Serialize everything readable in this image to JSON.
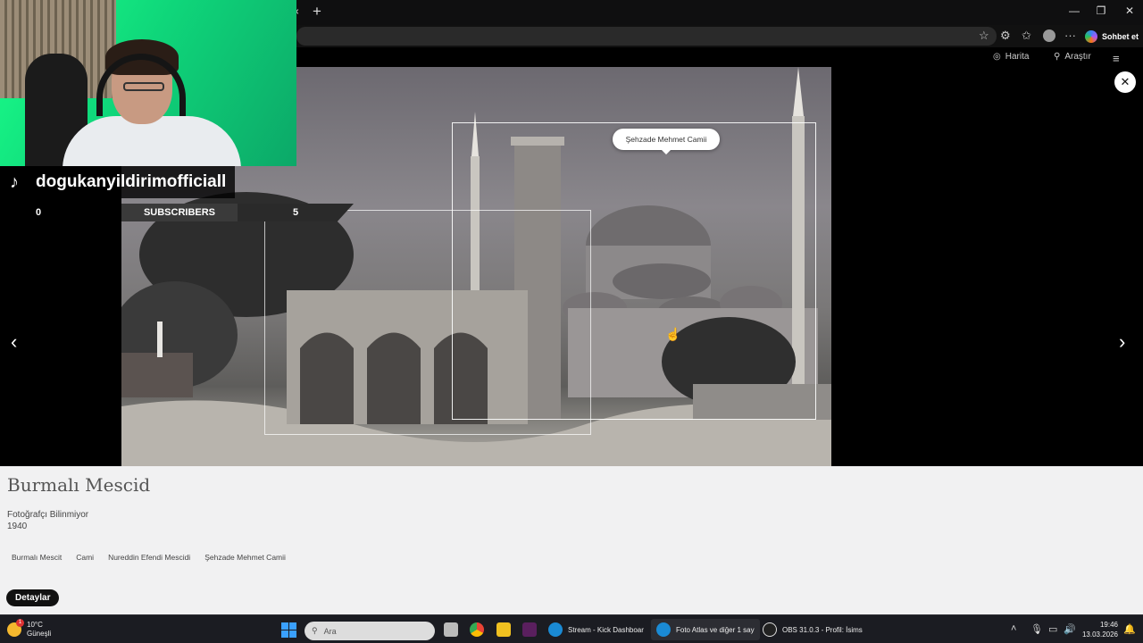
{
  "browser": {
    "tab_close": "×",
    "new_tab": "+",
    "window": {
      "minimize": "—",
      "restore": "❐",
      "close": "✕"
    },
    "address_icons": {
      "favorite": "☆",
      "more": "···"
    },
    "copilot_label": "Sohbet et"
  },
  "viewer": {
    "nav": {
      "map_label": "Harita",
      "search_label": "Araştır"
    },
    "close": "✕",
    "prev": "‹",
    "next": "›",
    "tooltip": "Şehzade Mehmet Camii"
  },
  "stream_overlay": {
    "tiktok_handle": "dogukanyildirimofficiall",
    "counter_left": "0",
    "subscribers_label": "SUBSCRIBERS",
    "counter_right": "5"
  },
  "info": {
    "title": "Burmalı Mescid",
    "photographer": "Fotoğrafçı Bilinmiyor",
    "year": "1940",
    "tags": [
      "Burmalı Mescit",
      "Cami",
      "Nureddin Efendi Mescidi",
      "Şehzade Mehmet Camii"
    ],
    "details_button": "Detaylar"
  },
  "taskbar": {
    "weather_temp": "10°C",
    "weather_desc": "Güneşli",
    "weather_badge": "1",
    "search_placeholder": "Ara",
    "apps": [
      {
        "label": "Stream - Kick Dashboar",
        "color": "#0b8f5a"
      },
      {
        "label": "Foto Atlas ve diğer 1 say",
        "color": "#1a8ad4"
      },
      {
        "label": "OBS 31.0.3 - Profil: İsims",
        "color": "#222222"
      }
    ],
    "time": "19:46",
    "date": "13.03.2026"
  },
  "colors": {
    "accent": "#3aa0ff",
    "panel_bg": "#f1f1f2",
    "webcam_green": "#1aff8a"
  }
}
